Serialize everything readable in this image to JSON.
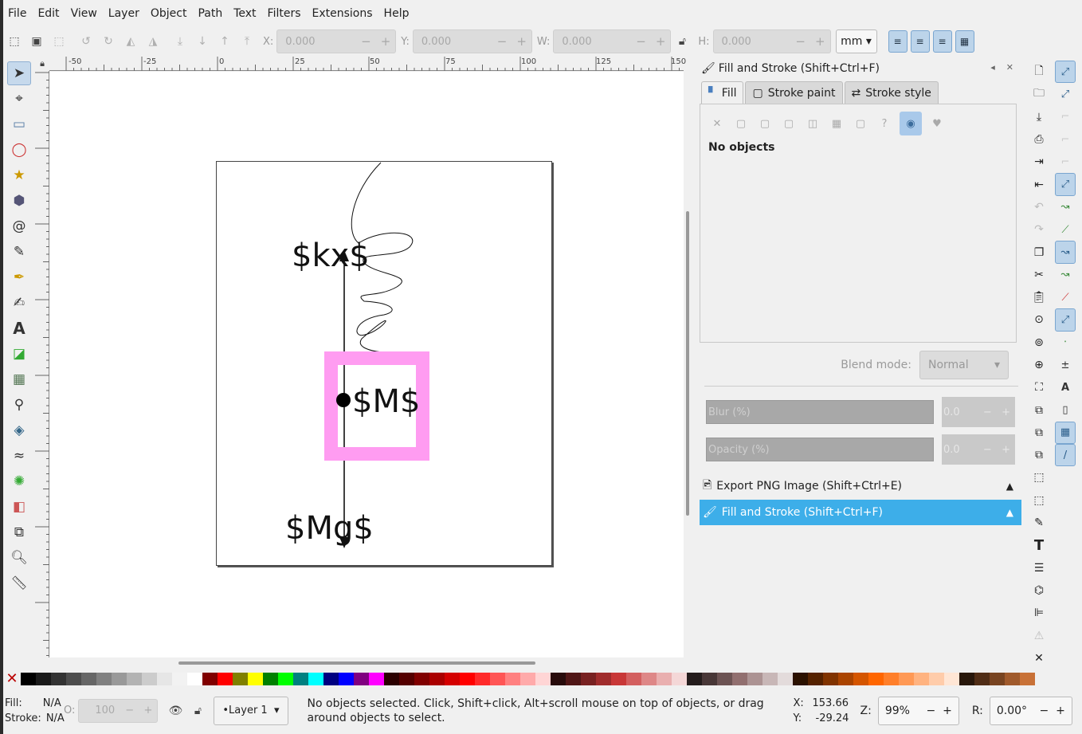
{
  "menu": [
    "File",
    "Edit",
    "View",
    "Layer",
    "Object",
    "Path",
    "Text",
    "Filters",
    "Extensions",
    "Help"
  ],
  "toolbar": {
    "x_label": "X:",
    "x_value": "0.000",
    "y_label": "Y:",
    "y_value": "0.000",
    "w_label": "W:",
    "w_value": "0.000",
    "h_label": "H:",
    "h_value": "0.000",
    "unit": "mm"
  },
  "ruler": {
    "top_ticks": [
      "-50",
      "-25",
      "0",
      "25",
      "50",
      "75",
      "100",
      "125",
      "150"
    ]
  },
  "canvas": {
    "label_kx": "$kx$",
    "label_M": "$M$",
    "label_Mg": "$Mg$",
    "pink": "#ff9cf1"
  },
  "dock": {
    "title": "Fill and Stroke (Shift+Ctrl+F)",
    "tabs": [
      "Fill",
      "Stroke paint",
      "Stroke style"
    ],
    "no_objects": "No objects",
    "blend_label": "Blend mode:",
    "blend_value": "Normal",
    "blur_label": "Blur (%)",
    "blur_value": "0.0",
    "opacity_label": "Opacity (%)",
    "opacity_value": "0.0",
    "export_row": "Export PNG Image (Shift+Ctrl+E)",
    "fillstroke_row": "Fill and Stroke (Shift+Ctrl+F)"
  },
  "status": {
    "fill_label": "Fill:",
    "fill_value": "N/A",
    "stroke_label": "Stroke:",
    "stroke_value": "N/A",
    "opacity_label": "O:",
    "opacity_value": "100",
    "layer": "•Layer 1",
    "message": "No objects selected. Click, Shift+click, Alt+scroll mouse on top of objects, or drag around objects to select.",
    "x_label": "X:",
    "x_value": "153.66",
    "y_label": "Y:",
    "y_value": "-29.24",
    "zoom_label": "Z:",
    "zoom_value": "99%",
    "rot_label": "R:",
    "rot_value": "0.00°"
  },
  "palette": [
    "#000000",
    "#1a1a1a",
    "#333333",
    "#4d4d4d",
    "#666666",
    "#808080",
    "#999999",
    "#b3b3b3",
    "#cccccc",
    "#e6e6e6",
    "#f2f2f2",
    "#ffffff",
    "#800000",
    "#ff0000",
    "#808000",
    "#ffff00",
    "#008000",
    "#00ff00",
    "#008080",
    "#00ffff",
    "#000080",
    "#0000ff",
    "#800080",
    "#ff00ff",
    "#2b0000",
    "#550000",
    "#800000",
    "#aa0000",
    "#d40000",
    "#ff0000",
    "#ff2a2a",
    "#ff5555",
    "#ff8080",
    "#ffaaaa",
    "#ffd5d5",
    "#280b0b",
    "#501616",
    "#782121",
    "#a02c2c",
    "#c83737",
    "#d35f5f",
    "#de8787",
    "#e9afaf",
    "#f4d7d7",
    "#241c1c",
    "#483737",
    "#6c5353",
    "#916f6f",
    "#ac9393",
    "#c8b7b7",
    "#e3dbdb",
    "#2b1100",
    "#552200",
    "#803300",
    "#aa4400",
    "#d45500",
    "#ff6600",
    "#ff7f2a",
    "#ff9955",
    "#ffb380",
    "#ffccaa",
    "#ffe6d5",
    "#28170b",
    "#502d16",
    "#784421",
    "#a05a2c",
    "#c87137"
  ]
}
